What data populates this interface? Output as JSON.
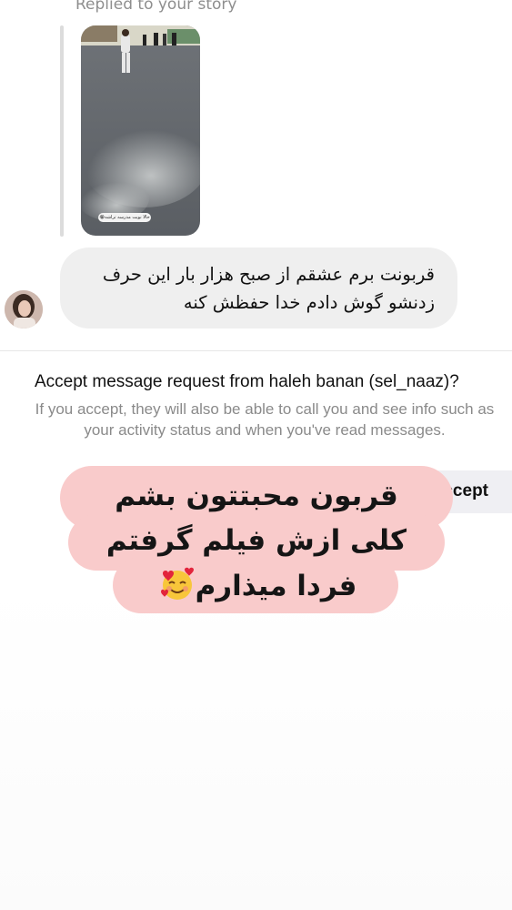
{
  "story_reply": {
    "label": "Replied to your story",
    "thumbnail_caption": "حالا نوبت مدرسه تراشه😭"
  },
  "message": {
    "line1": "قربونت برم عشقم از صبح هزار بار این حرف",
    "line2": "زدنشو گوش دادم خدا حفظش کنه"
  },
  "request": {
    "title": "Accept message request from haleh banan (sel_naaz)?",
    "description_line1": "If you accept, they will also be able to call you and see info such as",
    "description_line2": "your activity status and when you've read messages.",
    "accept_label": "Accept"
  },
  "overlay_text": {
    "line1": "قربون محبتتون بشم",
    "line2": "کلی ازش فیلم گرفتم",
    "line3": "فردا میذارم",
    "emoji": "smiling-face-with-hearts-icon"
  },
  "colors": {
    "bubble": "#efefef",
    "overlay_pill": "#f9cbcb",
    "secondary_text": "#8e8e8e"
  }
}
